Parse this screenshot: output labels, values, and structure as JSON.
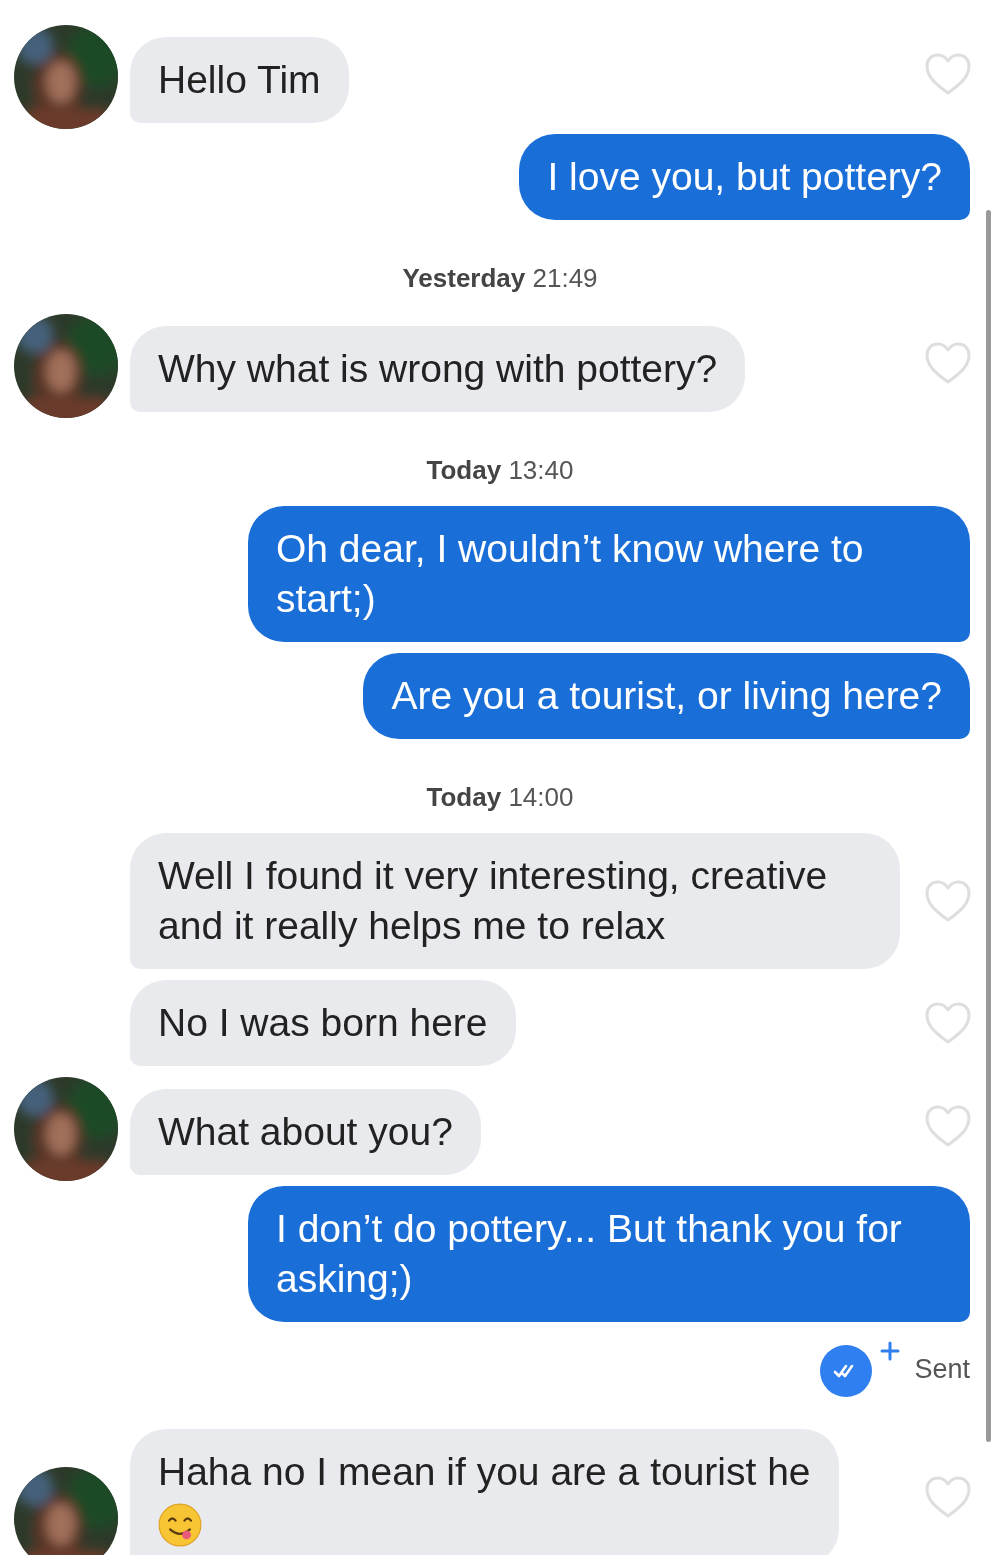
{
  "messages": [
    {
      "kind": "received",
      "text": "Hello Tim",
      "avatar": true,
      "liked": false
    },
    {
      "kind": "sent",
      "text": "I love you, but pottery?"
    },
    {
      "kind": "timestamp",
      "text": "**Yesterday** 21:49"
    },
    {
      "kind": "received",
      "text": "Why what is wrong with pottery?",
      "avatar": true,
      "liked": false
    },
    {
      "kind": "timestamp",
      "text": "**Today** 13:40"
    },
    {
      "kind": "sent",
      "text": "Oh dear, I wouldn’t know where to start;)"
    },
    {
      "kind": "sent",
      "text": "Are you a tourist, or living here?"
    },
    {
      "kind": "timestamp",
      "text": "**Today** 14:00"
    },
    {
      "kind": "received",
      "text": "Well I found it very interesting, creative and it really helps me to relax",
      "avatar": false,
      "liked": false
    },
    {
      "kind": "received",
      "text": "No I was born here",
      "avatar": false,
      "liked": false
    },
    {
      "kind": "received",
      "text": "What about you?",
      "avatar": true,
      "liked": false
    },
    {
      "kind": "sent",
      "text": "I don’t do pottery... But thank you for asking;)"
    },
    {
      "kind": "receipt",
      "text": "Sent"
    },
    {
      "kind": "received",
      "text": "Haha no I mean if you are a tourist he",
      "emoji": true,
      "avatar": true,
      "liked": false
    }
  ]
}
